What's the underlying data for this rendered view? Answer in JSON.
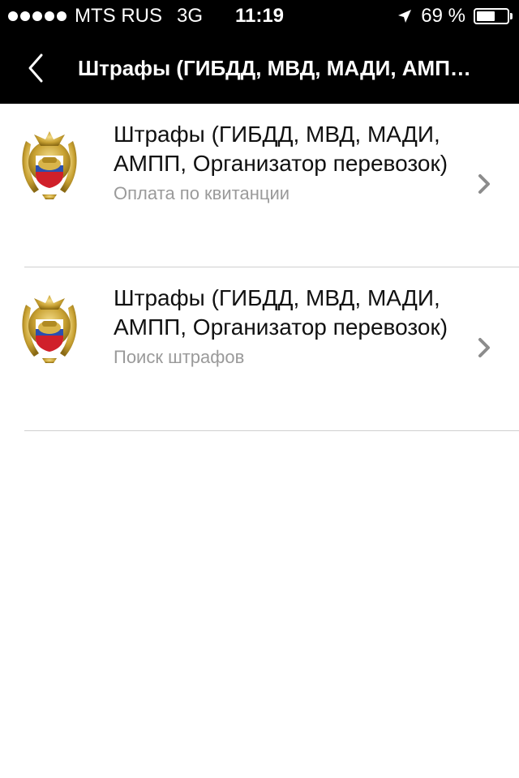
{
  "status_bar": {
    "carrier": "MTS RUS",
    "network": "3G",
    "time": "11:19",
    "battery_percent": "69 %",
    "battery_level": 0.69,
    "signal_bars": 5
  },
  "nav": {
    "title": "Штрафы (ГИБДД, МВД, МАДИ, АМП…",
    "back_icon": "chevron-left-icon"
  },
  "list": {
    "items": [
      {
        "title": "Штрафы (ГИБДД, МВД, МАДИ, АМПП, Организатор перевозок)",
        "subtitle": "Оплата по квитанции",
        "icon": "gibdd-emblem-icon"
      },
      {
        "title": "Штрафы (ГИБДД, МВД, МАДИ, АМПП, Организатор перевозок)",
        "subtitle": "Поиск штрафов",
        "icon": "gibdd-emblem-icon"
      }
    ]
  },
  "colors": {
    "bar_background": "#000000",
    "title_text": "#111111",
    "subtitle_text": "#9a9a9a",
    "chevron": "#8c8c8c",
    "divider": "#cfcfcf",
    "emblem_gold": "#c9a233",
    "flag_white": "#ffffff",
    "flag_blue": "#2a4fb0",
    "flag_red": "#d0202a"
  }
}
